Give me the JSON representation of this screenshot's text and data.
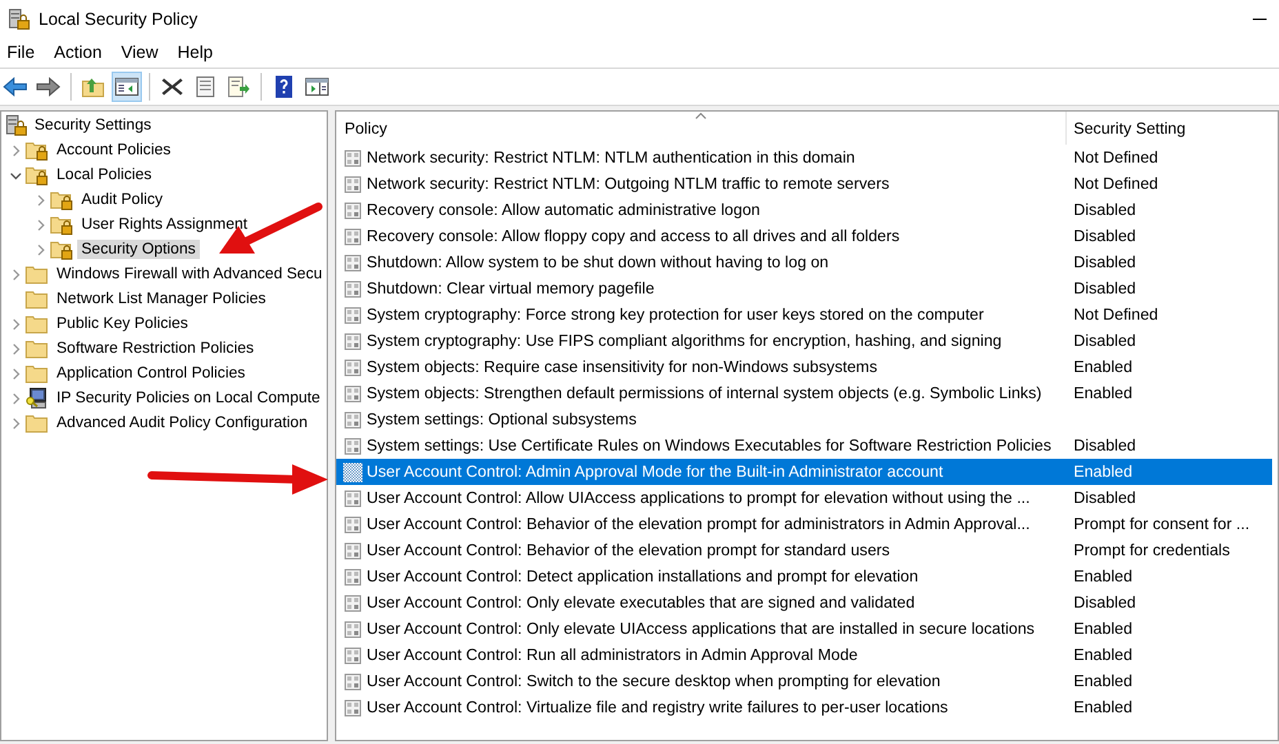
{
  "window": {
    "title": "Local Security Policy"
  },
  "menu": [
    "File",
    "Action",
    "View",
    "Help"
  ],
  "toolbar": [
    {
      "kind": "back",
      "pressed": false
    },
    {
      "kind": "forward",
      "pressed": false
    },
    {
      "kind": "up",
      "pressed": false
    },
    {
      "kind": "tree",
      "pressed": true
    },
    {
      "kind": "delete",
      "pressed": false
    },
    {
      "kind": "properties",
      "pressed": false
    },
    {
      "kind": "export",
      "pressed": false
    },
    {
      "kind": "help",
      "pressed": false
    },
    {
      "kind": "pane",
      "pressed": false
    }
  ],
  "tree": [
    {
      "label": "Security Settings",
      "kind": "server",
      "selected": false,
      "children": [
        {
          "label": "Account Policies",
          "kind": "locked-folder",
          "expanded": false,
          "selected": false
        },
        {
          "label": "Local Policies",
          "kind": "locked-folder",
          "expanded": true,
          "selected": false,
          "children": [
            {
              "label": "Audit Policy",
              "kind": "locked-folder",
              "expanded": false,
              "selected": false
            },
            {
              "label": "User Rights Assignment",
              "kind": "locked-folder",
              "expanded": false,
              "selected": false
            },
            {
              "label": "Security Options",
              "kind": "locked-folder",
              "expanded": false,
              "selected": true
            }
          ]
        },
        {
          "label": "Windows Firewall with Advanced Secu",
          "kind": "folder",
          "expanded": false,
          "selected": false
        },
        {
          "label": "Network List Manager Policies",
          "kind": "folder",
          "selected": false
        },
        {
          "label": "Public Key Policies",
          "kind": "folder",
          "expanded": false,
          "selected": false
        },
        {
          "label": "Software Restriction Policies",
          "kind": "folder",
          "expanded": false,
          "selected": false
        },
        {
          "label": "Application Control Policies",
          "kind": "folder",
          "expanded": false,
          "selected": false
        },
        {
          "label": "IP Security Policies on Local Compute",
          "kind": "computer",
          "expanded": false,
          "selected": false
        },
        {
          "label": "Advanced Audit Policy Configuration",
          "kind": "folder",
          "expanded": false,
          "selected": false
        }
      ]
    }
  ],
  "table": {
    "columns": [
      "Policy",
      "Security Setting"
    ],
    "rows": [
      {
        "policy": "Network security: Restrict NTLM: NTLM authentication in this domain",
        "setting": "Not Defined",
        "selected": false
      },
      {
        "policy": "Network security: Restrict NTLM: Outgoing NTLM traffic to remote servers",
        "setting": "Not Defined",
        "selected": false
      },
      {
        "policy": "Recovery console: Allow automatic administrative logon",
        "setting": "Disabled",
        "selected": false
      },
      {
        "policy": "Recovery console: Allow floppy copy and access to all drives and all folders",
        "setting": "Disabled",
        "selected": false
      },
      {
        "policy": "Shutdown: Allow system to be shut down without having to log on",
        "setting": "Disabled",
        "selected": false
      },
      {
        "policy": "Shutdown: Clear virtual memory pagefile",
        "setting": "Disabled",
        "selected": false
      },
      {
        "policy": "System cryptography: Force strong key protection for user keys stored on the computer",
        "setting": "Not Defined",
        "selected": false
      },
      {
        "policy": "System cryptography: Use FIPS compliant algorithms for encryption, hashing, and signing",
        "setting": "Disabled",
        "selected": false
      },
      {
        "policy": "System objects: Require case insensitivity for non-Windows subsystems",
        "setting": "Enabled",
        "selected": false
      },
      {
        "policy": "System objects: Strengthen default permissions of internal system objects (e.g. Symbolic Links)",
        "setting": "Enabled",
        "selected": false
      },
      {
        "policy": "System settings: Optional subsystems",
        "setting": "",
        "selected": false
      },
      {
        "policy": "System settings: Use Certificate Rules on Windows Executables for Software Restriction Policies",
        "setting": "Disabled",
        "selected": false
      },
      {
        "policy": "User Account Control: Admin Approval Mode for the Built-in Administrator account",
        "setting": "Enabled",
        "selected": true
      },
      {
        "policy": "User Account Control: Allow UIAccess applications to prompt for elevation without using the ...",
        "setting": "Disabled",
        "selected": false
      },
      {
        "policy": "User Account Control: Behavior of the elevation prompt for administrators in Admin Approval...",
        "setting": "Prompt for consent for ...",
        "selected": false
      },
      {
        "policy": "User Account Control: Behavior of the elevation prompt for standard users",
        "setting": "Prompt for credentials",
        "selected": false
      },
      {
        "policy": "User Account Control: Detect application installations and prompt for elevation",
        "setting": "Enabled",
        "selected": false
      },
      {
        "policy": "User Account Control: Only elevate executables that are signed and validated",
        "setting": "Disabled",
        "selected": false
      },
      {
        "policy": "User Account Control: Only elevate UIAccess applications that are installed in secure locations",
        "setting": "Enabled",
        "selected": false
      },
      {
        "policy": "User Account Control: Run all administrators in Admin Approval Mode",
        "setting": "Enabled",
        "selected": false
      },
      {
        "policy": "User Account Control: Switch to the secure desktop when prompting for elevation",
        "setting": "Enabled",
        "selected": false
      },
      {
        "policy": "User Account Control: Virtualize file and registry write failures to per-user locations",
        "setting": "Enabled",
        "selected": false
      }
    ]
  }
}
